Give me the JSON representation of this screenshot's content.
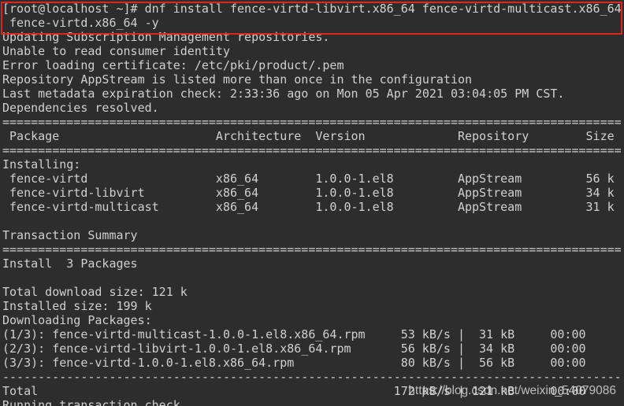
{
  "terminal": {
    "colors": {
      "background": "#2d2d2d",
      "text": "#d0d0d0",
      "highlight_box": "#e0251f",
      "watermark": "#d8d8d8"
    }
  },
  "command": {
    "prompt": "[root@localhost ~]#",
    "text": "dnf install fence-virtd-libvirt.x86_64 fence-virtd-multicast.x86_64",
    "continuation": "fence-virtd.x86_64 -y"
  },
  "messages": [
    "Updating Subscription Management repositories.",
    "Unable to read consumer identity",
    "Error loading certificate: /etc/pki/product/.pem",
    "Repository AppStream is listed more than once in the configuration",
    "Last metadata expiration check: 2:33:36 ago on Mon 05 Apr 2021 03:04:05 PM CST.",
    "Dependencies resolved."
  ],
  "separator": "=======================================================================================",
  "package_table": {
    "headers": [
      "Package",
      "Architecture",
      "Version",
      "Repository",
      "Size"
    ],
    "section": "Installing:",
    "rows": [
      [
        "fence-virtd",
        "x86_64",
        "1.0.0-1.el8",
        "AppStream",
        "56 k"
      ],
      [
        "fence-virtd-libvirt",
        "x86_64",
        "1.0.0-1.el8",
        "AppStream",
        "34 k"
      ],
      [
        "fence-virtd-multicast",
        "x86_64",
        "1.0.0-1.el8",
        "AppStream",
        "31 k"
      ]
    ]
  },
  "transaction_summary": {
    "title": "Transaction Summary",
    "install": "Install  3 Packages"
  },
  "sizes": {
    "download": "Total download size: 121 k",
    "installed": "Installed size: 199 k"
  },
  "downloading": {
    "heading": "Downloading Packages:",
    "divider": "|",
    "rows": [
      {
        "file": "(1/3): fence-virtd-multicast-1.0.0-1.el8.x86_64.rpm",
        "rate": "53 kB/s",
        "size": "31 kB",
        "time": "00:00"
      },
      {
        "file": "(2/3): fence-virtd-libvirt-1.0.0-1.el8.x86_64.rpm",
        "rate": "56 kB/s",
        "size": "34 kB",
        "time": "00:00"
      },
      {
        "file": "(3/3): fence-virtd-1.0.0-1.el8.x86_64.rpm",
        "rate": "80 kB/s",
        "size": "56 kB",
        "time": "00:00"
      }
    ],
    "dash_separator": "---------------------------------------------------------------------------------------",
    "total": {
      "label": "Total",
      "rate": "172 kB/s",
      "size": "121 kB",
      "time": "00:00"
    }
  },
  "next_line": "Running transaction check",
  "watermark": "https://blog.csdn.net/weixin_54079086"
}
